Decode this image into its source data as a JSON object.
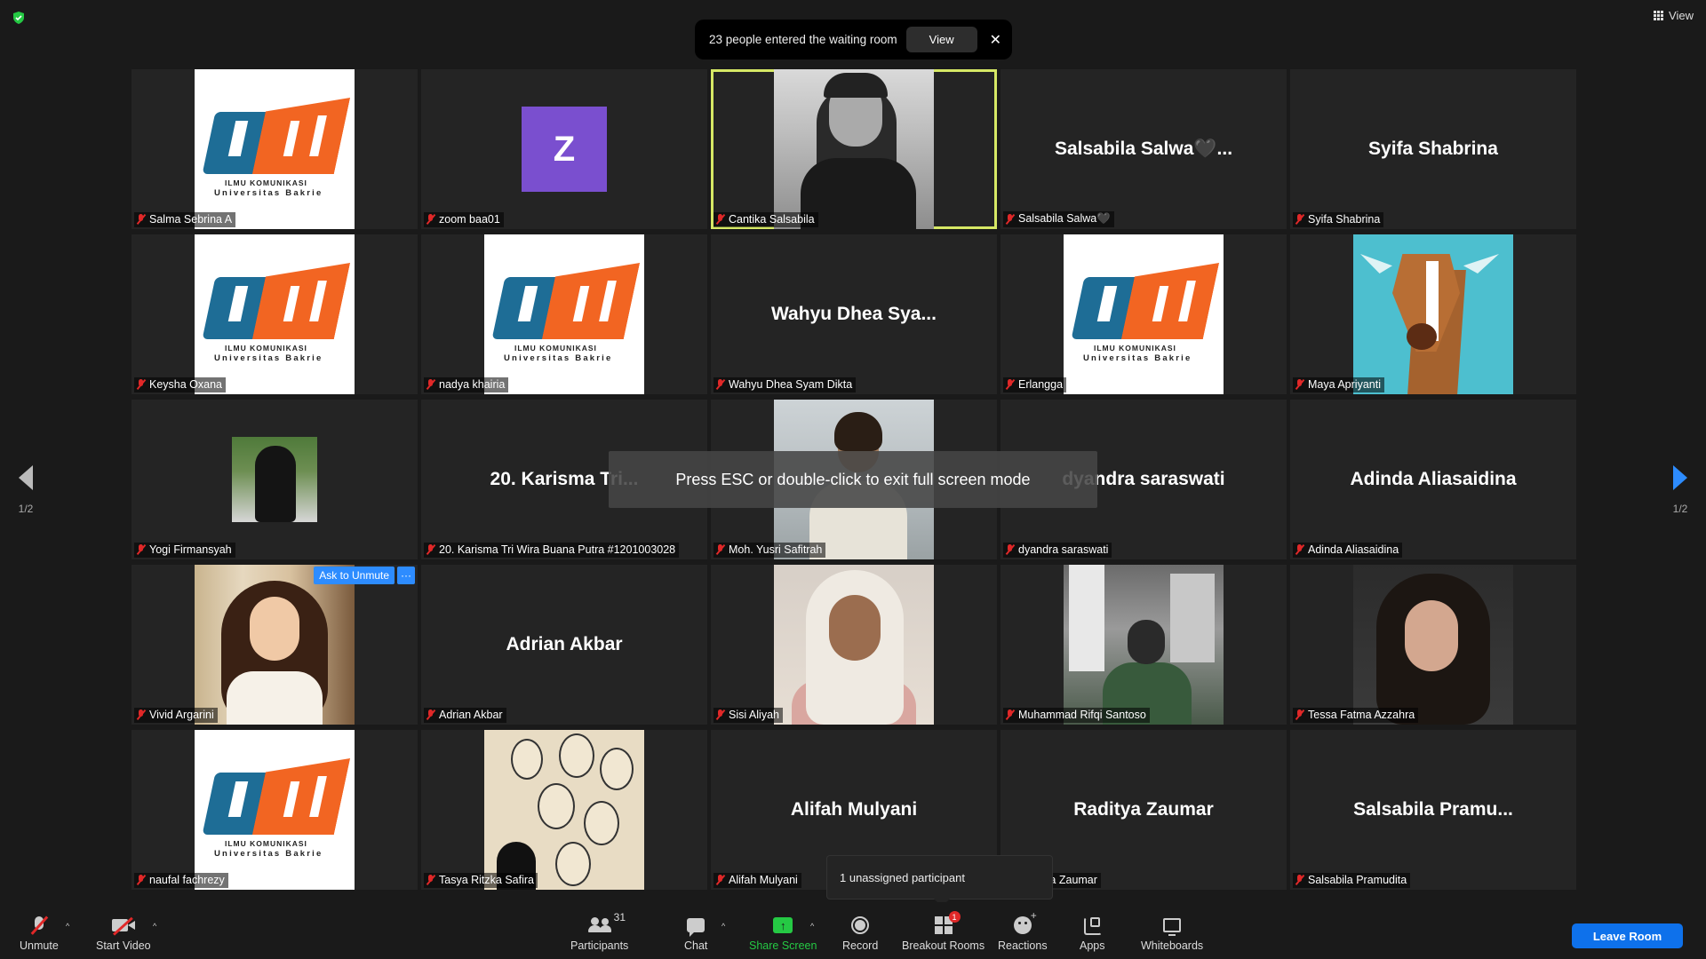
{
  "topbar": {
    "view_label": "View"
  },
  "waiting_room": {
    "message": "23 people entered the waiting room",
    "view_button": "View",
    "close": "✕"
  },
  "pagination": {
    "left": "1/2",
    "right": "1/2"
  },
  "hm_logo": {
    "line1": "ILMU KOMUNIKASI",
    "line2": "Universitas Bakrie"
  },
  "tiles": [
    {
      "label": "Salma Sebrina A",
      "big": ""
    },
    {
      "label": "zoom baa01",
      "big": "",
      "avatar_letter": "Z"
    },
    {
      "label": "Cantika Salsabila",
      "big": ""
    },
    {
      "label": "Salsabila Salwa🖤",
      "big": "Salsabila  Salwa🖤..."
    },
    {
      "label": "Syifa Shabrina",
      "big": "Syifa Shabrina"
    },
    {
      "label": "Keysha Oxana",
      "big": ""
    },
    {
      "label": "nadya khairia",
      "big": ""
    },
    {
      "label": "Wahyu Dhea Syam Dikta",
      "big": "Wahyu  Dhea  Sya..."
    },
    {
      "label": "Erlangga",
      "big": ""
    },
    {
      "label": "Maya Apriyanti",
      "big": ""
    },
    {
      "label": "Yogi Firmansyah",
      "big": ""
    },
    {
      "label": "20. Karisma Tri Wira Buana Putra #1201003028",
      "big": "20. Karisma  Tri..."
    },
    {
      "label": "Moh. Yusri Safitrah",
      "big": ""
    },
    {
      "label": "dyandra saraswati",
      "big": "dyandra saraswati"
    },
    {
      "label": "Adinda Aliasaidina",
      "big": "Adinda Aliasaidina"
    },
    {
      "label": "Vivid Argarini",
      "big": "",
      "ask_unmute": "Ask to Unmute",
      "more": "···"
    },
    {
      "label": "Adrian Akbar",
      "big": "Adrian Akbar"
    },
    {
      "label": "Sisi Aliyah",
      "big": ""
    },
    {
      "label": "Muhammad Rifqi Santoso",
      "big": ""
    },
    {
      "label": "Tessa Fatma Azzahra",
      "big": ""
    },
    {
      "label": "naufal fachrezy",
      "big": ""
    },
    {
      "label": "Tasya Ritzka Safira",
      "big": ""
    },
    {
      "label": "Alifah Mulyani",
      "big": "Alifah Mulyani"
    },
    {
      "label": "Raditya Zaumar",
      "big": "Raditya Zaumar",
      "label_visible": "a Zaumar"
    },
    {
      "label": "Salsabila Pramudita",
      "big": "Salsabila  Pramu..."
    }
  ],
  "fullscreen_notice": "Press ESC or double-click to exit full screen mode",
  "breakout_popup": "1 unassigned participant",
  "toolbar": {
    "unmute": "Unmute",
    "start_video": "Start Video",
    "participants": "Participants",
    "participants_count": "31",
    "chat": "Chat",
    "share_screen": "Share Screen",
    "record": "Record",
    "breakout_rooms": "Breakout Rooms",
    "breakout_badge": "1",
    "reactions": "Reactions",
    "apps": "Apps",
    "whiteboards": "Whiteboards",
    "leave_room": "Leave Room",
    "caret": "^"
  },
  "colors": {
    "accent": "#2d8cff",
    "leave": "#0e71eb",
    "share_green": "#25c944",
    "muted_red": "#e02828",
    "active_speaker": "#d6e865"
  }
}
